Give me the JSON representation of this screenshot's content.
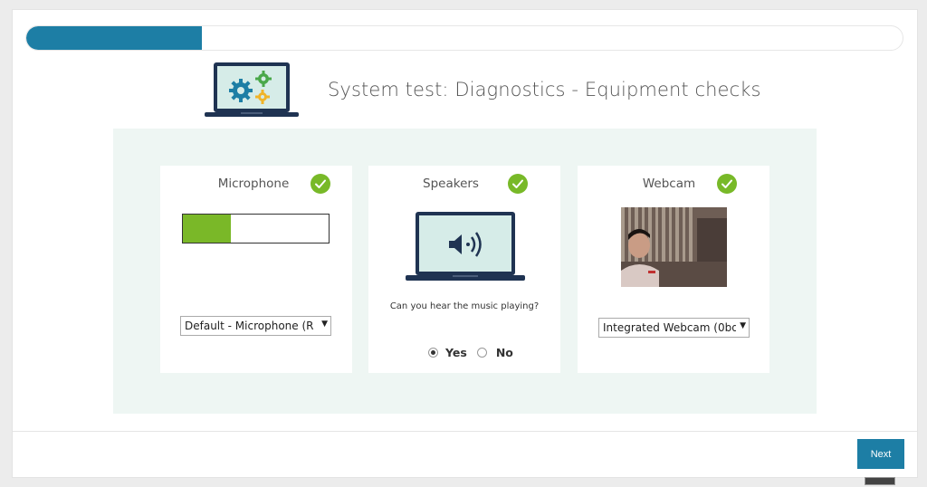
{
  "progress": {
    "percent": 20
  },
  "header": {
    "title": "System test: Diagnostics - Equipment checks",
    "icon": "laptop-gears-icon"
  },
  "microphone": {
    "title": "Microphone",
    "status": "check",
    "level_percent": 33,
    "device": "Default - Microphone (R"
  },
  "speakers": {
    "title": "Speakers",
    "status": "check",
    "question": "Can you hear the music playing?",
    "yes_label": "Yes",
    "no_label": "No",
    "selected": "Yes"
  },
  "webcam": {
    "title": "Webcam",
    "status": "check",
    "device": "Integrated Webcam (0bd"
  },
  "footer": {
    "next_label": "Next"
  },
  "colors": {
    "accent": "#1d7ea5",
    "check": "#78b928",
    "panel_bg": "#eef6f3"
  }
}
